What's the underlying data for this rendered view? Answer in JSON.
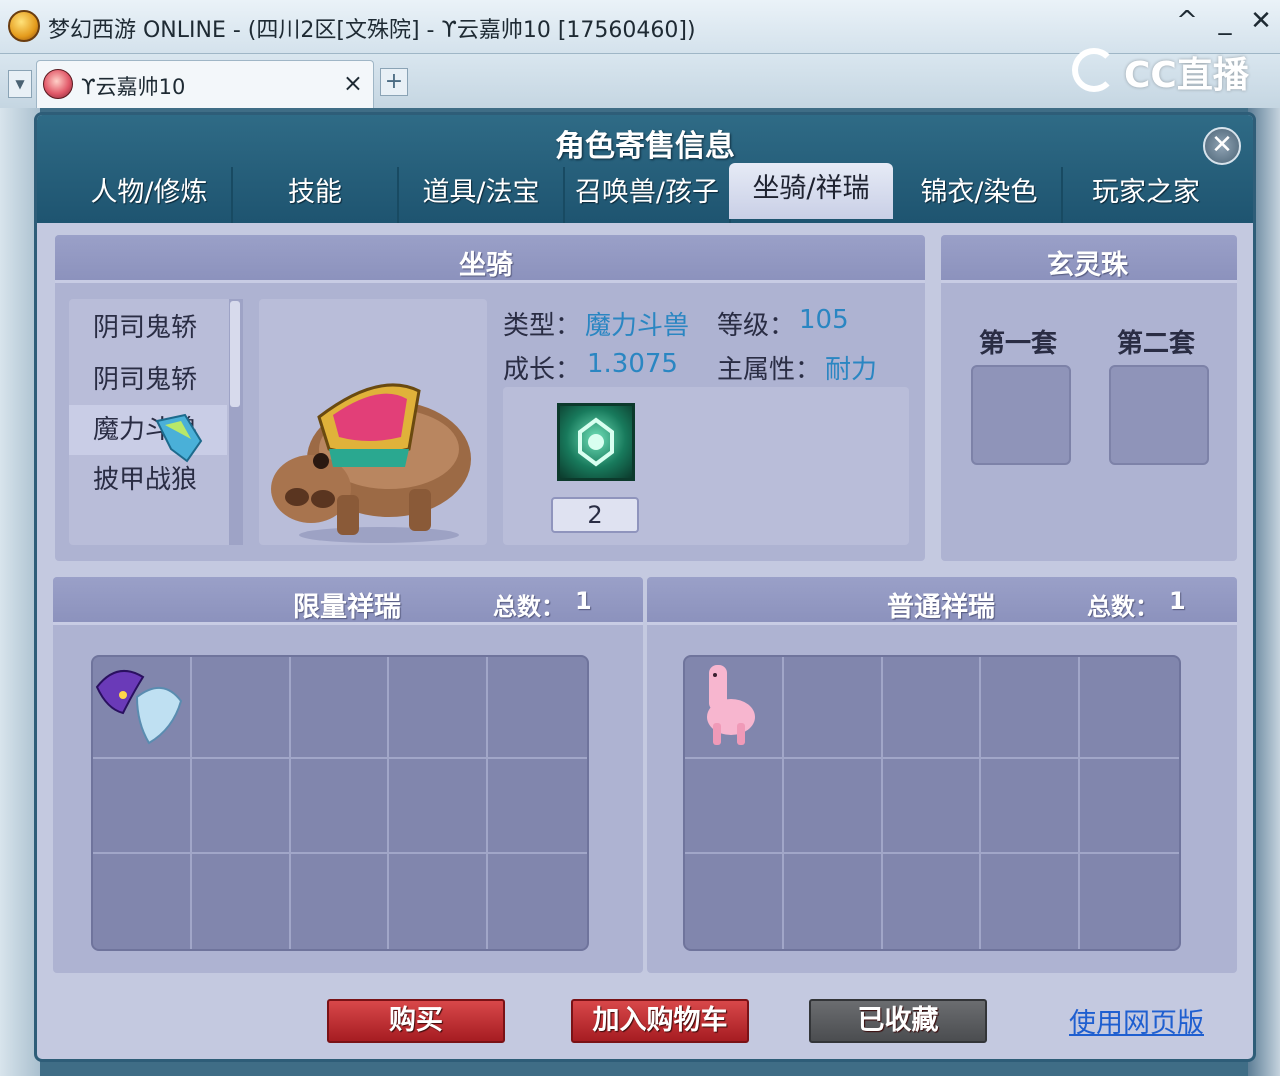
{
  "window": {
    "title": "梦幻西游 ONLINE - (四川2区[文殊院] - ϒ云嘉帅10 [17560460])",
    "controls": {
      "collapse": "^",
      "minimize": "_",
      "close": "✕"
    }
  },
  "browser_tab": {
    "title": "ϒ云嘉帅10",
    "close": "×",
    "add": "+"
  },
  "watermark": {
    "text": "CC直播"
  },
  "dialog": {
    "title": "角色寄售信息",
    "close": "✕",
    "tabs": [
      {
        "label": "人物/修炼"
      },
      {
        "label": "技能"
      },
      {
        "label": "道具/法宝"
      },
      {
        "label": "召唤兽/孩子"
      },
      {
        "label": "坐骑/祥瑞",
        "active": true
      },
      {
        "label": "锦衣/染色"
      },
      {
        "label": "玩家之家"
      }
    ]
  },
  "mount_panel": {
    "title": "坐骑",
    "list": [
      {
        "name": "阴司鬼轿"
      },
      {
        "name": "阴司鬼轿"
      },
      {
        "name": "魔力斗兽",
        "selected": true
      },
      {
        "name": "披甲战狼"
      }
    ],
    "type_label": "类型：",
    "type_value": "魔力斗兽",
    "level_label": "等级：",
    "level_value": "105",
    "growth_label": "成长：",
    "growth_value": "1.3075",
    "main_attr_label": "主属性：",
    "main_attr_value": "耐力",
    "skill_level": "2"
  },
  "bead_panel": {
    "title": "玄灵珠",
    "sets": [
      {
        "label": "第一套"
      },
      {
        "label": "第二套"
      }
    ]
  },
  "limited_panel": {
    "title": "限量祥瑞",
    "count_label": "总数：",
    "count": "1"
  },
  "normal_panel": {
    "title": "普通祥瑞",
    "count_label": "总数：",
    "count": "1"
  },
  "buttons": {
    "buy": "购买",
    "add_cart": "加入购物车",
    "favorited": "已收藏",
    "web_version": "使用网页版"
  },
  "colors": {
    "header": "#2f6b86",
    "panel": "#aeb3d2",
    "value_blue": "#2a86c2",
    "button_red": "#a61c22"
  }
}
